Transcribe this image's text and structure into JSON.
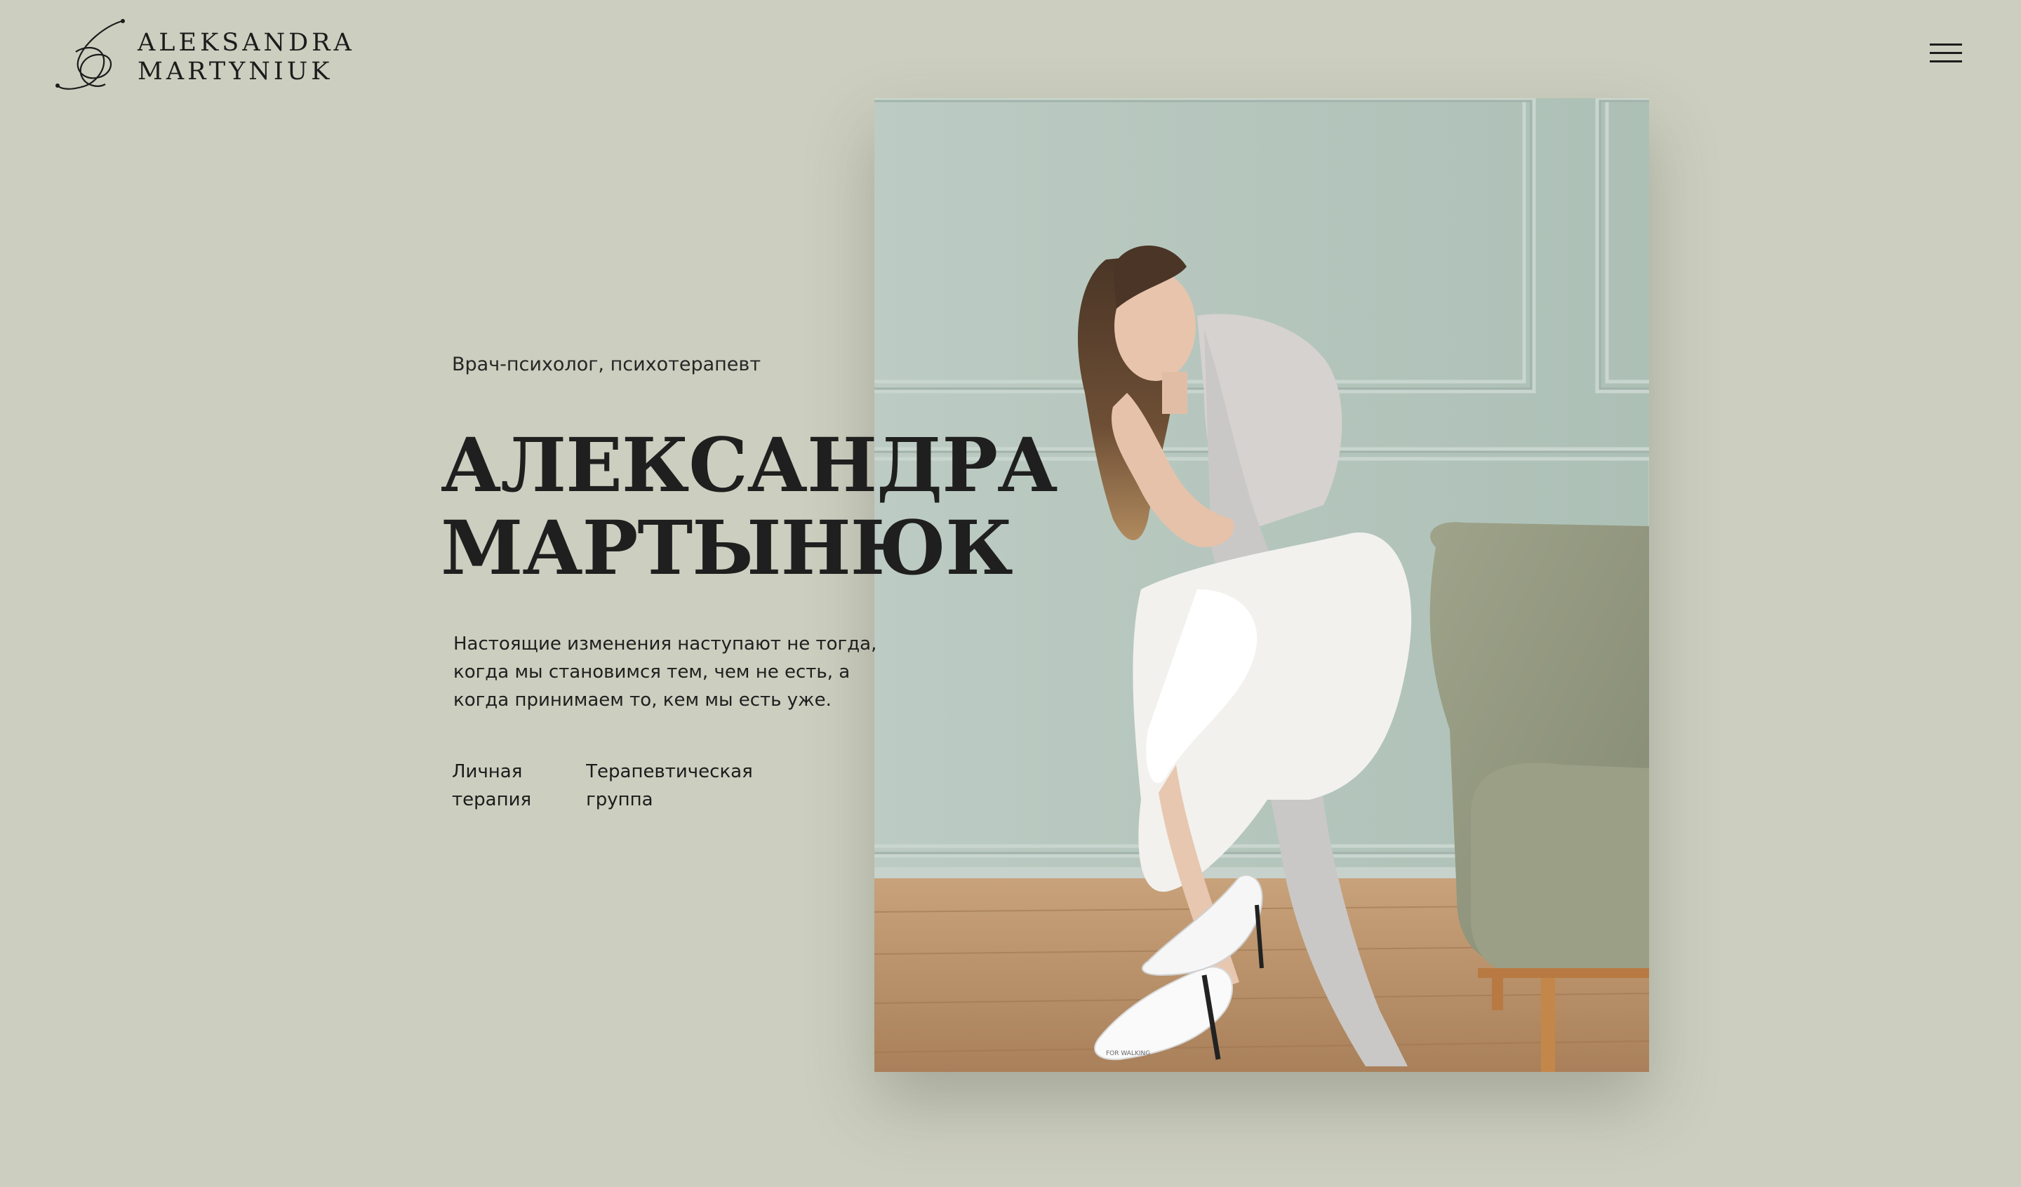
{
  "brand": {
    "line1": "ALEKSANDRA",
    "line2": "MARTYNIUK"
  },
  "header": {
    "menu_icon": "hamburger-menu-icon"
  },
  "hero": {
    "subtitle": "Врач-психолог, психотерапевт",
    "title_line1": "АЛЕКСАНДРА",
    "title_line2": "МАРТЫНЮК",
    "quote_lines": [
      "Настоящие изменения наступают не тогда,",
      "когда мы становимся тем, чем не есть, а",
      "когда принимаем то, кем мы есть уже."
    ],
    "links": [
      {
        "line1": "Личная",
        "line2": "терапия"
      },
      {
        "line1": "Терапевтическая",
        "line2": "группа"
      }
    ]
  },
  "photo": {
    "shoe_brand": "FOR WALKING"
  },
  "colors": {
    "background": "#cccebf",
    "text": "#1c1c1c",
    "wall": "#b8c7be",
    "floor": "#b88e62",
    "armchair": "#95997f"
  }
}
